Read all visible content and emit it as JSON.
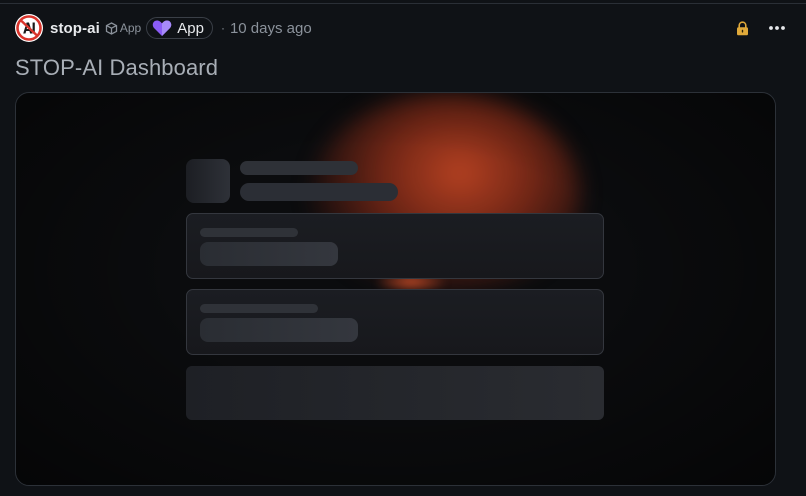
{
  "post": {
    "author": "stop-ai",
    "app_chip_label": "App",
    "app_pill_label": "App",
    "separator": "·",
    "timestamp": "10 days ago",
    "title": "STOP-AI Dashboard"
  },
  "icons": {
    "avatar": "stop-ai-logo",
    "app_chip": "cube-icon",
    "app_pill": "heart-app-icon",
    "lock": "lock-icon",
    "more": "more-horizontal-icon"
  },
  "colors": {
    "background": "#0f1216",
    "lock_accent": "#e0a93a",
    "app_pill_icon": "#8b5cf6",
    "glow": "#be4423",
    "avatar_ring": "#d9342b"
  }
}
